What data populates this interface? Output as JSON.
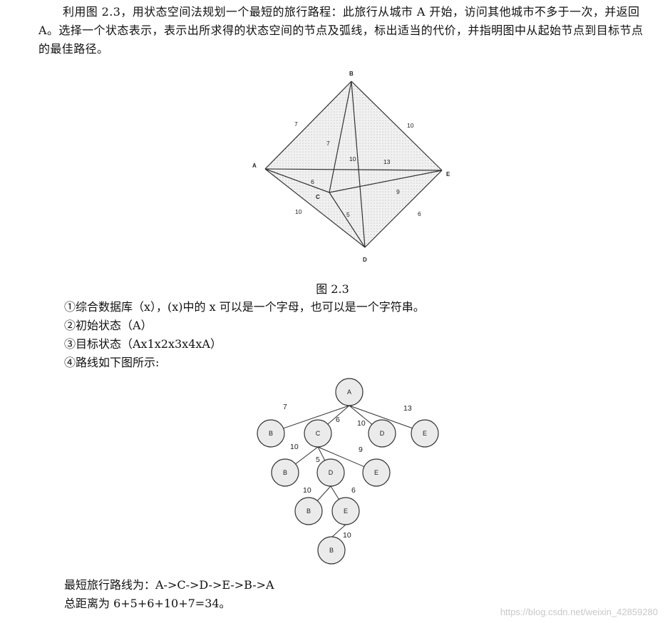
{
  "paragraph": "利用图 2.3，用状态空间法规划一个最短的旅行路程：此旅行从城市 A 开始，访问其他城市不多于一次，并返回 A。选择一个状态表示，表示出所求得的状态空间的节点及弧线，标出适当的代价，并指明图中从起始节点到目标节点的最佳路径。",
  "figure1": {
    "caption": "图 2.3",
    "nodes": {
      "A": "A",
      "B": "B",
      "C": "C",
      "D": "D",
      "E": "E"
    },
    "edge_labels": {
      "AB": "7",
      "BC": "7",
      "BD": "10",
      "BE": "10",
      "AE": "13",
      "AC": "6",
      "CE": "9",
      "AD": "10",
      "CD": "5",
      "DE": "6"
    }
  },
  "items": [
    "①综合数据库（x），(x)中的 x 可以是一个字母，也可以是一个字符串。",
    "②初始状态（A）",
    "③目标状态（Ax1x2x3x4xA）",
    "④路线如下图所示:"
  ],
  "figure2": {
    "nodes": {
      "root": "A",
      "l1_b": "B",
      "l1_c": "C",
      "l1_d": "D",
      "l1_e": "E",
      "l2_b": "B",
      "l2_d": "D",
      "l2_e": "E",
      "l3_b": "B",
      "l3_e": "E",
      "l4_b": "B"
    },
    "edge_labels": {
      "a_b": "7",
      "a_c": "6",
      "a_d": "10",
      "a_e": "13",
      "c_b": "10",
      "c_d": "5",
      "c_e": "9",
      "d_b": "10",
      "d_e": "6",
      "e_b": "10"
    }
  },
  "result": {
    "line1": "最短旅行路线为：A->C->D->E->B->A",
    "line2": "总距离为 6+5+6+10+7=34。"
  },
  "watermark": "https://blog.csdn.net/weixin_42859280"
}
